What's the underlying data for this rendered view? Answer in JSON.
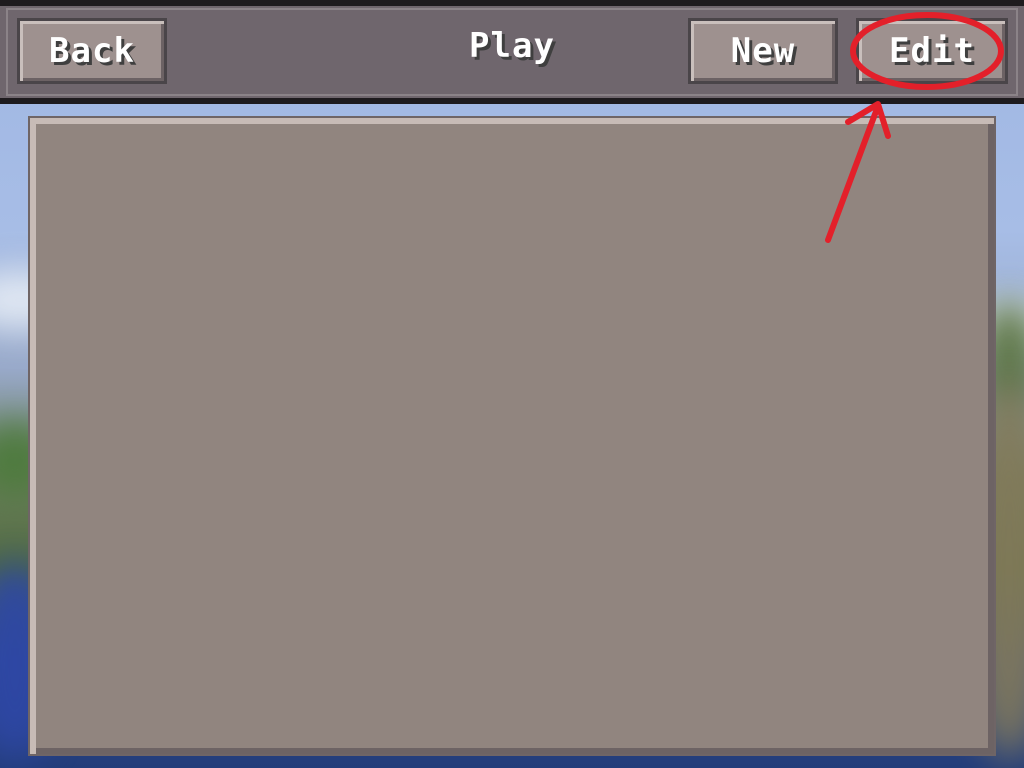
{
  "header": {
    "title": "Play",
    "back_label": "Back",
    "new_label": "New",
    "edit_label": "Edit"
  },
  "colors": {
    "annotation": "#e3202a"
  }
}
